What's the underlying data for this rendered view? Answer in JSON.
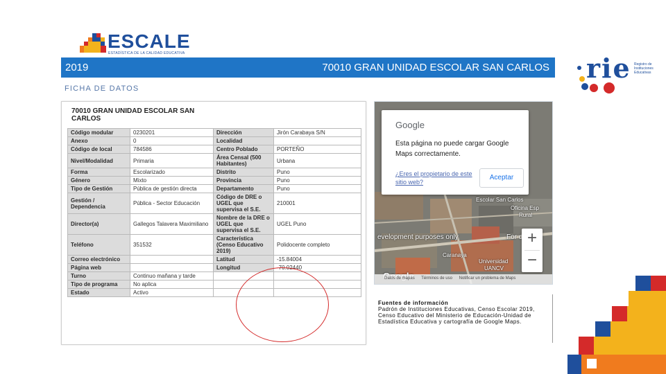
{
  "brand": {
    "name": "ESCALE",
    "tagline": "ESTADÍSTICA DE LA CALIDAD EDUCATIVA",
    "rie_name": "rie",
    "rie_desc": "Registro de Instituciones Educativas",
    "colors": {
      "blue": "#1f4f9c",
      "header": "#1f75c6",
      "red": "#d42a2a",
      "yellow": "#f3b21c",
      "orange": "#f07b1e"
    }
  },
  "header": {
    "year": "2019",
    "school": "70010 GRAN UNIDAD ESCOLAR SAN CARLOS"
  },
  "section_title": "FICHA DE DATOS",
  "card": {
    "title": "70010 GRAN UNIDAD ESCOLAR SAN CARLOS",
    "rows": [
      [
        "Código modular",
        "0230201",
        "Dirección",
        "Jirón Carabaya S/N"
      ],
      [
        "Anexo",
        "0",
        "Localidad",
        ""
      ],
      [
        "Código de local",
        "784586",
        "Centro Poblado",
        "PORTEÑO"
      ],
      [
        "Nivel/Modalidad",
        "Primaria",
        "Área Censal (500 Habitantes)",
        "Urbana"
      ],
      [
        "Forma",
        "Escolarizado",
        "Distrito",
        "Puno"
      ],
      [
        "Género",
        "Mixto",
        "Provincia",
        "Puno"
      ],
      [
        "Tipo de Gestión",
        "Pública de gestión directa",
        "Departamento",
        "Puno"
      ],
      [
        "Gestión / Dependencia",
        "Pública - Sector Educación",
        "Código de DRE o UGEL que supervisa el S.E.",
        "210001"
      ],
      [
        "Director(a)",
        "Gallegos Talavera Maximiliano",
        "Nombre de la DRE o UGEL que supervisa el S.E.",
        "UGEL Puno"
      ],
      [
        "Teléfono",
        "351532",
        "Característica (Censo Educativo 2019)",
        "Polidocente completo"
      ],
      [
        "Correo electrónico",
        "",
        "Latitud",
        "-15.84004"
      ],
      [
        "Página web",
        "",
        "Longitud",
        "-70.02440"
      ],
      [
        "Turno",
        "Continuo mañana y tarde",
        "",
        ""
      ],
      [
        "Tipo de programa",
        "No aplica",
        "",
        ""
      ],
      [
        "Estado",
        "Activo",
        "",
        ""
      ]
    ]
  },
  "map": {
    "google": "Google",
    "error_message": "Esta página no puede cargar Google Maps correctamente.",
    "owner_link": "¿Eres el propietario de este sitio web?",
    "accept": "Aceptar",
    "dev_left": "evelopment purposes only",
    "dev_right": "For devel",
    "zoom_in": "+",
    "zoom_out": "−",
    "label_school": "Escolar San Carlos",
    "label_oficina": "Oficina Esp",
    "label_rural": "Rural",
    "label_caraaya": "Caranaya",
    "label_univ": "Universidad",
    "label_uancv": "UANCV",
    "footer": [
      "Datos de mapas",
      "Términos de uso",
      "Notificar un problema de Maps"
    ]
  },
  "fuentes": {
    "title": "Fuentes de información",
    "text": "Padrón de Instituciones Educativas, Censo Escolar 2019, Censo Educativo del Ministerio de Educación-Unidad de Estadística Educativa y cartografía de Google Maps."
  }
}
